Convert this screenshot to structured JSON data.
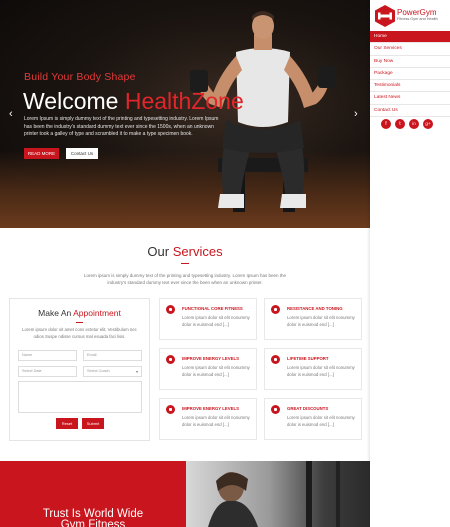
{
  "hero": {
    "subtitle": "Build Your Body Shape",
    "title_main": "Welcome ",
    "title_accent": "HealthZone",
    "description": "Lorem Ipsum is simply dummy text of the printing and typesetting industry. Lorem Ipsum has been the industry's standard dummy text ever since the 1500s, when an unknown printer took a galley of type and scrambled it to make a type specimen book.",
    "read_more": "READ MORE",
    "contact": "Contact Us",
    "prev_icon": "chevron-left-icon",
    "next_icon": "chevron-right-icon"
  },
  "sidebar": {
    "logo_name": "PowerGym",
    "logo_tag": "Fitness Gym and Health",
    "nav": [
      {
        "label": "Home",
        "active": true
      },
      {
        "label": "Our Services"
      },
      {
        "label": "Buy Now"
      },
      {
        "label": "Package"
      },
      {
        "label": "Testimonials"
      },
      {
        "label": "Latest News"
      },
      {
        "label": "Contact Us"
      }
    ],
    "social": [
      "f",
      "t",
      "in",
      "g+"
    ]
  },
  "services": {
    "title_main": "Our ",
    "title_accent": "Services",
    "description": "Lorem ipsum is simply dummy text of the printing and typesetting industry. Lorem Ipsum has been the industry's standard dummy text ever since the been when an unknown printer.",
    "cards": [
      {
        "title": "FUNCTIONAL CORE FITNESS",
        "desc": "Lorem ipsum dolor sit elit nonummy dolor is euismod end [...]"
      },
      {
        "title": "RESISTANCE AND TONING",
        "desc": "Lorem ipsum dolor sit elit nonummy dolor is euismod end [...]"
      },
      {
        "title": "IMPROVE ENERGY LEVELS",
        "desc": "Lorem ipsum dolor sit elit nonummy dolor is euismod end [...]"
      },
      {
        "title": "LIFETIME SUPPORT",
        "desc": "Lorem ipsum dolor sit elit nonummy dolor is euismod end [...]"
      },
      {
        "title": "IMPROVE ENERGY LEVELS",
        "desc": "Lorem ipsum dolor sit elit nonummy dolor is euismod end [...]"
      },
      {
        "title": "GREAT DISCOUNTS",
        "desc": "Lorem ipsum dolor sit elit nonummy dolor is euismod end [...]"
      }
    ]
  },
  "appointment": {
    "title_main": "Make An ",
    "title_accent": "Appointment",
    "description": "Lorem ipsum dolor sit amet cons ectetur elit. Vestibulum nec odios Suspe ndisse cursus mal esuada faci lisis.",
    "name_placeholder": "Name",
    "email_placeholder": "Email",
    "date_placeholder": "Select Date",
    "trainer_value": "Select Coach",
    "message_placeholder": "",
    "reset": "Reset",
    "submit": "Submit"
  },
  "bottom": {
    "line1": "Trust Is World Wide",
    "line2": "Gym Fitness"
  },
  "colors": {
    "accent": "#c9161e"
  }
}
